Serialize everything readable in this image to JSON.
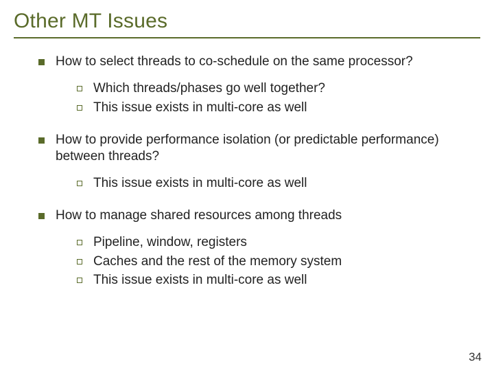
{
  "title": "Other MT Issues",
  "items": [
    {
      "text": "How to select threads to co-schedule on the same processor?",
      "subs": [
        "Which threads/phases go well together?",
        "This issue exists in multi-core as well"
      ]
    },
    {
      "text": "How to provide performance isolation (or predictable performance) between threads?",
      "subs": [
        "This issue exists in multi-core as well"
      ]
    },
    {
      "text": "How to manage shared resources among threads",
      "subs": [
        "Pipeline, window, registers",
        "Caches and the rest of the memory system",
        "This issue exists in multi-core as well"
      ]
    }
  ],
  "page_number": "34"
}
